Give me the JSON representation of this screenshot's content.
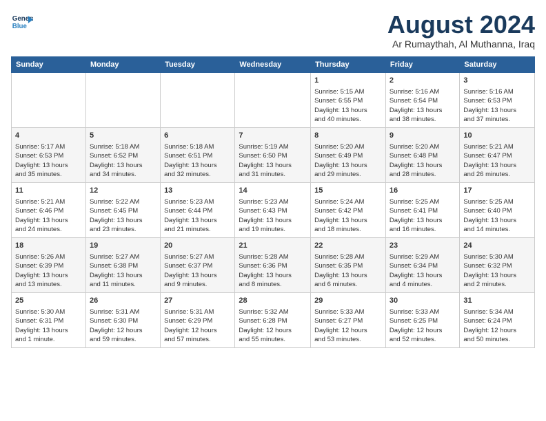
{
  "logo": {
    "line1": "General",
    "line2": "Blue"
  },
  "title": "August 2024",
  "subtitle": "Ar Rumaythah, Al Muthanna, Iraq",
  "days_of_week": [
    "Sunday",
    "Monday",
    "Tuesday",
    "Wednesday",
    "Thursday",
    "Friday",
    "Saturday"
  ],
  "weeks": [
    [
      {
        "day": "",
        "content": ""
      },
      {
        "day": "",
        "content": ""
      },
      {
        "day": "",
        "content": ""
      },
      {
        "day": "",
        "content": ""
      },
      {
        "day": "1",
        "content": "Sunrise: 5:15 AM\nSunset: 6:55 PM\nDaylight: 13 hours\nand 40 minutes."
      },
      {
        "day": "2",
        "content": "Sunrise: 5:16 AM\nSunset: 6:54 PM\nDaylight: 13 hours\nand 38 minutes."
      },
      {
        "day": "3",
        "content": "Sunrise: 5:16 AM\nSunset: 6:53 PM\nDaylight: 13 hours\nand 37 minutes."
      }
    ],
    [
      {
        "day": "4",
        "content": "Sunrise: 5:17 AM\nSunset: 6:53 PM\nDaylight: 13 hours\nand 35 minutes."
      },
      {
        "day": "5",
        "content": "Sunrise: 5:18 AM\nSunset: 6:52 PM\nDaylight: 13 hours\nand 34 minutes."
      },
      {
        "day": "6",
        "content": "Sunrise: 5:18 AM\nSunset: 6:51 PM\nDaylight: 13 hours\nand 32 minutes."
      },
      {
        "day": "7",
        "content": "Sunrise: 5:19 AM\nSunset: 6:50 PM\nDaylight: 13 hours\nand 31 minutes."
      },
      {
        "day": "8",
        "content": "Sunrise: 5:20 AM\nSunset: 6:49 PM\nDaylight: 13 hours\nand 29 minutes."
      },
      {
        "day": "9",
        "content": "Sunrise: 5:20 AM\nSunset: 6:48 PM\nDaylight: 13 hours\nand 28 minutes."
      },
      {
        "day": "10",
        "content": "Sunrise: 5:21 AM\nSunset: 6:47 PM\nDaylight: 13 hours\nand 26 minutes."
      }
    ],
    [
      {
        "day": "11",
        "content": "Sunrise: 5:21 AM\nSunset: 6:46 PM\nDaylight: 13 hours\nand 24 minutes."
      },
      {
        "day": "12",
        "content": "Sunrise: 5:22 AM\nSunset: 6:45 PM\nDaylight: 13 hours\nand 23 minutes."
      },
      {
        "day": "13",
        "content": "Sunrise: 5:23 AM\nSunset: 6:44 PM\nDaylight: 13 hours\nand 21 minutes."
      },
      {
        "day": "14",
        "content": "Sunrise: 5:23 AM\nSunset: 6:43 PM\nDaylight: 13 hours\nand 19 minutes."
      },
      {
        "day": "15",
        "content": "Sunrise: 5:24 AM\nSunset: 6:42 PM\nDaylight: 13 hours\nand 18 minutes."
      },
      {
        "day": "16",
        "content": "Sunrise: 5:25 AM\nSunset: 6:41 PM\nDaylight: 13 hours\nand 16 minutes."
      },
      {
        "day": "17",
        "content": "Sunrise: 5:25 AM\nSunset: 6:40 PM\nDaylight: 13 hours\nand 14 minutes."
      }
    ],
    [
      {
        "day": "18",
        "content": "Sunrise: 5:26 AM\nSunset: 6:39 PM\nDaylight: 13 hours\nand 13 minutes."
      },
      {
        "day": "19",
        "content": "Sunrise: 5:27 AM\nSunset: 6:38 PM\nDaylight: 13 hours\nand 11 minutes."
      },
      {
        "day": "20",
        "content": "Sunrise: 5:27 AM\nSunset: 6:37 PM\nDaylight: 13 hours\nand 9 minutes."
      },
      {
        "day": "21",
        "content": "Sunrise: 5:28 AM\nSunset: 6:36 PM\nDaylight: 13 hours\nand 8 minutes."
      },
      {
        "day": "22",
        "content": "Sunrise: 5:28 AM\nSunset: 6:35 PM\nDaylight: 13 hours\nand 6 minutes."
      },
      {
        "day": "23",
        "content": "Sunrise: 5:29 AM\nSunset: 6:34 PM\nDaylight: 13 hours\nand 4 minutes."
      },
      {
        "day": "24",
        "content": "Sunrise: 5:30 AM\nSunset: 6:32 PM\nDaylight: 13 hours\nand 2 minutes."
      }
    ],
    [
      {
        "day": "25",
        "content": "Sunrise: 5:30 AM\nSunset: 6:31 PM\nDaylight: 13 hours\nand 1 minute."
      },
      {
        "day": "26",
        "content": "Sunrise: 5:31 AM\nSunset: 6:30 PM\nDaylight: 12 hours\nand 59 minutes."
      },
      {
        "day": "27",
        "content": "Sunrise: 5:31 AM\nSunset: 6:29 PM\nDaylight: 12 hours\nand 57 minutes."
      },
      {
        "day": "28",
        "content": "Sunrise: 5:32 AM\nSunset: 6:28 PM\nDaylight: 12 hours\nand 55 minutes."
      },
      {
        "day": "29",
        "content": "Sunrise: 5:33 AM\nSunset: 6:27 PM\nDaylight: 12 hours\nand 53 minutes."
      },
      {
        "day": "30",
        "content": "Sunrise: 5:33 AM\nSunset: 6:25 PM\nDaylight: 12 hours\nand 52 minutes."
      },
      {
        "day": "31",
        "content": "Sunrise: 5:34 AM\nSunset: 6:24 PM\nDaylight: 12 hours\nand 50 minutes."
      }
    ]
  ]
}
